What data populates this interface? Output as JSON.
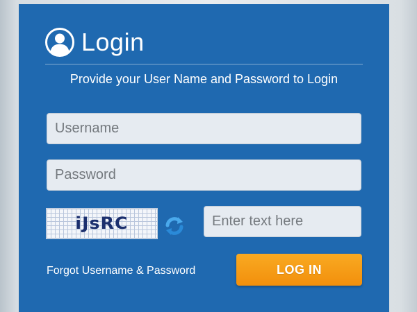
{
  "login": {
    "title": "Login",
    "subtitle": "Provide your User Name and Password to Login",
    "username": {
      "placeholder": "Username",
      "value": ""
    },
    "password": {
      "placeholder": "Password",
      "value": ""
    },
    "captcha": {
      "image_text": "iJsRC",
      "input_placeholder": "Enter text here",
      "refresh_icon": "refresh-icon"
    },
    "forgot_link": "Forgot Username & Password",
    "login_button": "LOG IN",
    "icons": {
      "header": "user-icon"
    }
  },
  "colors": {
    "panel": "#1f69b0",
    "button": "#f39a14",
    "field": "#e6ebf1",
    "text": "#ffffff"
  }
}
